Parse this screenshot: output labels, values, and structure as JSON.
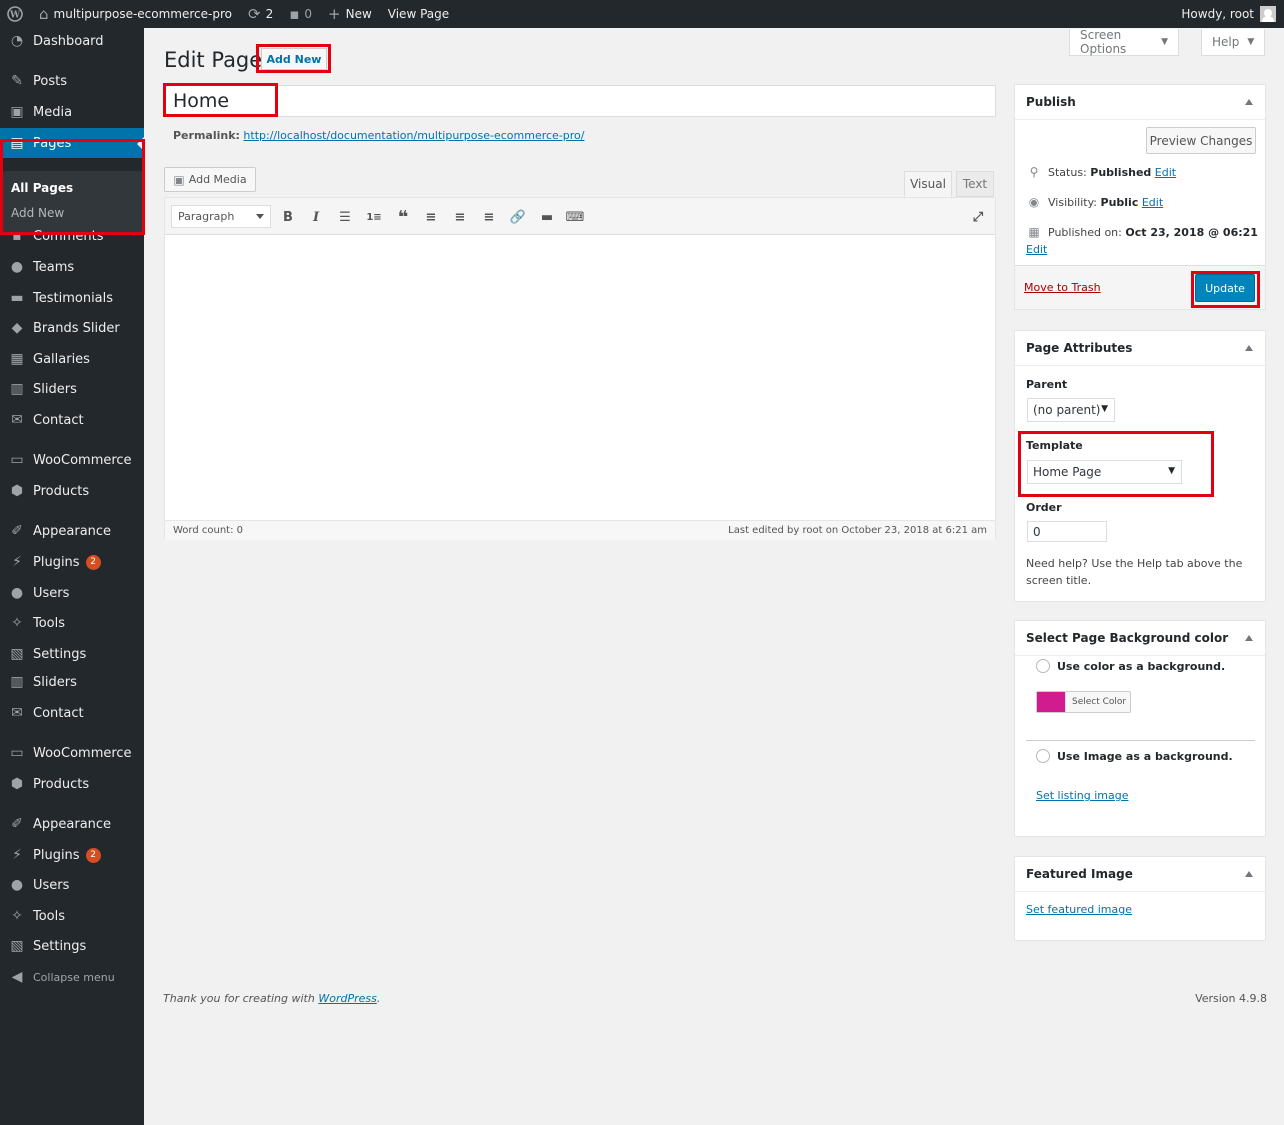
{
  "adminbar": {
    "site_name": "multipurpose-ecommerce-pro",
    "updates_count": "2",
    "comments_count": "0",
    "new_label": "New",
    "view_page_label": "View Page",
    "howdy": "Howdy, root"
  },
  "sidebar": {
    "items": [
      {
        "label": "Dashboard",
        "icon": "dashboard-icon"
      },
      {
        "label": "Posts",
        "icon": "pin-icon"
      },
      {
        "label": "Media",
        "icon": "media-icon"
      },
      {
        "label": "Pages",
        "icon": "pages-icon"
      },
      {
        "label": "Comments",
        "icon": "comment-icon"
      },
      {
        "label": "Teams",
        "icon": "groups-icon"
      },
      {
        "label": "Testimonials",
        "icon": "format-status-icon"
      },
      {
        "label": "Brands Slider",
        "icon": "tag-icon"
      },
      {
        "label": "Gallaries",
        "icon": "gallery-icon"
      },
      {
        "label": "Sliders",
        "icon": "slides-icon"
      },
      {
        "label": "Contact",
        "icon": "email-icon"
      },
      {
        "label": "WooCommerce",
        "icon": "woo-icon"
      },
      {
        "label": "Products",
        "icon": "archive-icon"
      },
      {
        "label": "Appearance",
        "icon": "paintbrush-icon"
      },
      {
        "label": "Plugins",
        "icon": "plugin-icon",
        "badge": "2"
      },
      {
        "label": "Users",
        "icon": "users-icon"
      },
      {
        "label": "Tools",
        "icon": "wrench-icon"
      },
      {
        "label": "Settings",
        "icon": "settings-icon"
      },
      {
        "label": "Sliders",
        "icon": "slides-icon"
      },
      {
        "label": "Contact",
        "icon": "email-icon"
      },
      {
        "label": "WooCommerce",
        "icon": "woo-icon"
      },
      {
        "label": "Products",
        "icon": "archive-icon"
      },
      {
        "label": "Appearance",
        "icon": "paintbrush-icon"
      },
      {
        "label": "Plugins",
        "icon": "plugin-icon",
        "badge": "2"
      },
      {
        "label": "Users",
        "icon": "users-icon"
      },
      {
        "label": "Tools",
        "icon": "wrench-icon"
      },
      {
        "label": "Settings",
        "icon": "settings-icon"
      },
      {
        "label": "Collapse menu",
        "icon": "collapse-icon"
      }
    ],
    "submenu": {
      "all_pages": "All Pages",
      "add_new": "Add New"
    }
  },
  "screen_options": "Screen Options",
  "help": "Help",
  "page_title": "Edit Page",
  "add_new_button": "Add New",
  "post_title": "Home",
  "permalink": {
    "label": "Permalink:",
    "url": "http://localhost/documentation/multipurpose-ecommerce-pro/"
  },
  "add_media": "Add Media",
  "tabs": {
    "visual": "Visual",
    "text": "Text"
  },
  "format_select": "Paragraph",
  "word_count": "Word count: 0",
  "last_edited": "Last edited by root on October 23, 2018 at 6:21 am",
  "publish": {
    "title": "Publish",
    "preview": "Preview Changes",
    "status_label": "Status:",
    "status_value": "Published",
    "visibility_label": "Visibility:",
    "visibility_value": "Public",
    "published_label": "Published on:",
    "published_value": "Oct 23, 2018 @ 06:21",
    "edit": "Edit",
    "trash": "Move to Trash",
    "update": "Update"
  },
  "attributes": {
    "title": "Page Attributes",
    "parent_label": "Parent",
    "parent_value": "(no parent)",
    "template_label": "Template",
    "template_value": "Home Page",
    "order_label": "Order",
    "order_value": "0",
    "help": "Need help? Use the Help tab above the screen title."
  },
  "background": {
    "title": "Select Page Background color",
    "use_color": "Use color as a background.",
    "select_color": "Select Color",
    "swatch_color": "#d11c8f",
    "use_image": "Use Image as a background.",
    "set_listing": "Set listing image"
  },
  "featured": {
    "title": "Featured Image",
    "set": "Set featured image"
  },
  "footer": {
    "thanks": "Thank you for creating with ",
    "wp": "WordPress",
    "dot": ".",
    "version": "Version 4.9.8"
  },
  "colors": {
    "accent": "#0073aa",
    "highlight": "#e3000f",
    "sidebar": "#23282d"
  }
}
